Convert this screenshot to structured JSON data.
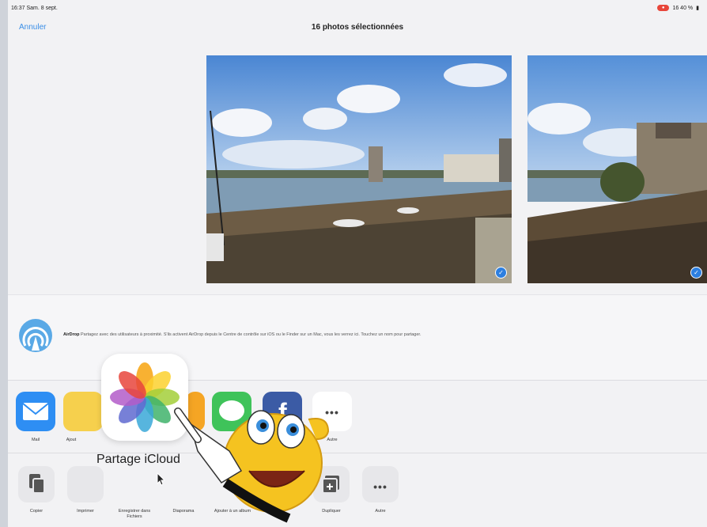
{
  "status": {
    "time": "16:37  Sam. 8 sept.",
    "battery": "16 40 %"
  },
  "nav": {
    "cancel_label": "Annuler",
    "title": "16 photos sélectionnées"
  },
  "airdrop": {
    "label": "AirDrop",
    "text": "Partagez avec des utilisateurs à proximité. S'ils activent AirDrop depuis le Centre de contrôle sur iOS ou le Finder sur un Mac, vous les verrez ici. Touchez un nom pour partager."
  },
  "apps": [
    {
      "label": "Mail",
      "icon": "mail-icon"
    },
    {
      "label": "Ajout",
      "icon": "notes-icon"
    },
    {
      "label": "",
      "icon": "pages-icon"
    },
    {
      "label": "",
      "icon": "messages-icon"
    },
    {
      "label": "",
      "icon": "facebook-icon"
    },
    {
      "label": "Autre",
      "icon": "more-icon"
    }
  ],
  "actions": [
    {
      "label": "Copier",
      "icon": "copy-icon"
    },
    {
      "label": "Imprimer",
      "icon": "print-icon"
    },
    {
      "label": "Enregistrer dans Fichiers",
      "icon": "folder-icon"
    },
    {
      "label": "Diaporama",
      "icon": "slideshow-icon"
    },
    {
      "label": "Ajouter à un album",
      "icon": "album-icon"
    },
    {
      "label": "Dupliquer",
      "icon": "duplicate-icon"
    },
    {
      "label": "Autre",
      "icon": "more-icon"
    }
  ],
  "popup": {
    "label": "Partage iCloud"
  },
  "colors": {
    "accent": "#3a8ee6",
    "check": "#2d7fe0",
    "record": "#e8463a"
  }
}
